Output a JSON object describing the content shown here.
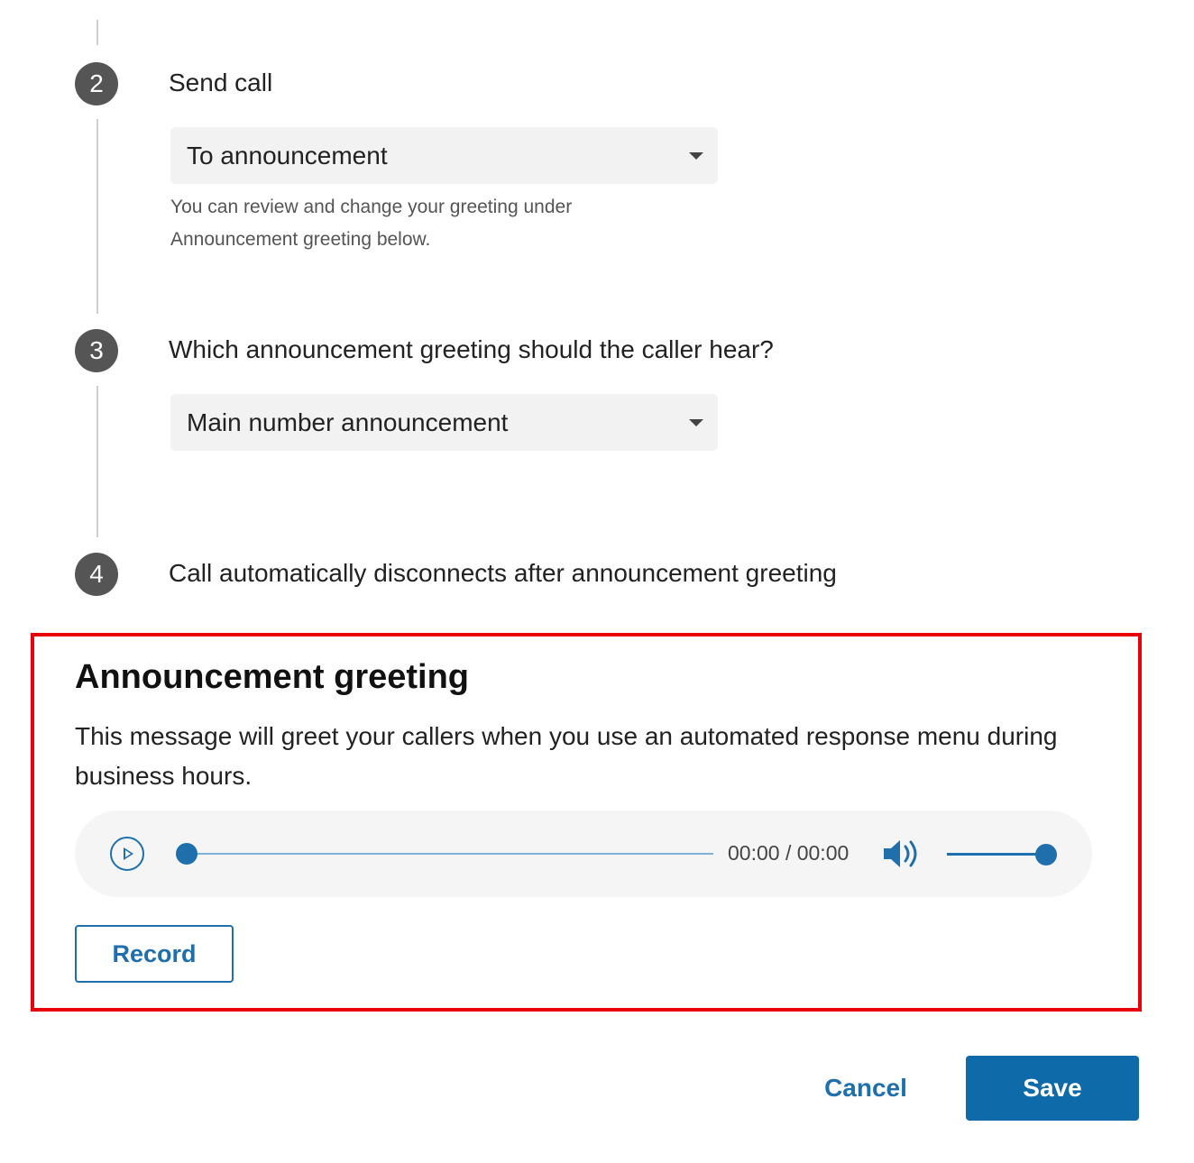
{
  "steps": [
    {
      "number": "2",
      "label": "Send call"
    },
    {
      "number": "3",
      "label": "Which announcement greeting should the caller hear?"
    },
    {
      "number": "4",
      "label": "Call automatically disconnects after announcement greeting"
    }
  ],
  "send_call": {
    "selected": "To announcement",
    "hint": "You can review and change your greeting under Announcement greeting below."
  },
  "greeting_select": {
    "selected": "Main number announcement"
  },
  "announcement": {
    "title": "Announcement greeting",
    "description": "This message will greet your callers when you use an automated response menu during business hours.",
    "player": {
      "time": "00:00 / 00:00",
      "progress": 0,
      "volume": 1.0
    },
    "record_label": "Record"
  },
  "footer": {
    "cancel_label": "Cancel",
    "save_label": "Save"
  },
  "colors": {
    "accent": "#1f6fad",
    "primary_button": "#0e6aa8",
    "highlight_border": "#e8000b",
    "step_circle": "#555555"
  },
  "icons": {
    "play": "play-icon",
    "volume": "volume-icon",
    "dropdown": "chevron-down-icon"
  }
}
